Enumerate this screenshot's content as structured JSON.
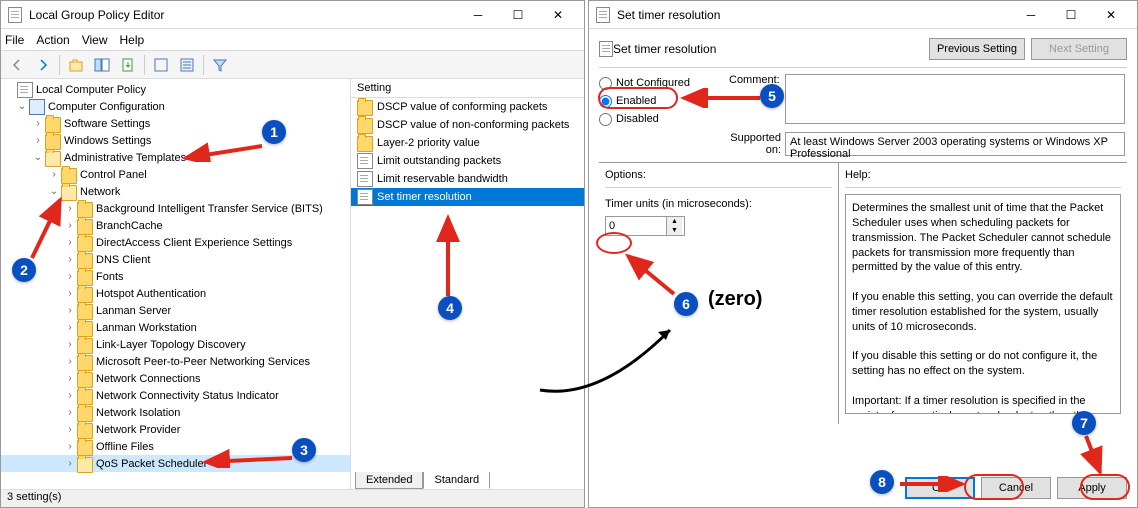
{
  "gpedit": {
    "title": "Local Group Policy Editor",
    "menus": [
      "File",
      "Action",
      "View",
      "Help"
    ],
    "status": "3 setting(s)",
    "root": "Local Computer Policy",
    "cc": "Computer Configuration",
    "tree_top": [
      "Software Settings",
      "Windows Settings",
      "Administrative Templates"
    ],
    "at_children": [
      "Control Panel",
      "Network"
    ],
    "network_children": [
      "Background Intelligent Transfer Service (BITS)",
      "BranchCache",
      "DirectAccess Client Experience Settings",
      "DNS Client",
      "Fonts",
      "Hotspot Authentication",
      "Lanman Server",
      "Lanman Workstation",
      "Link-Layer Topology Discovery",
      "Microsoft Peer-to-Peer Networking Services",
      "Network Connections",
      "Network Connectivity Status Indicator",
      "Network Isolation",
      "Network Provider",
      "Offline Files",
      "QoS Packet Scheduler"
    ],
    "list_header": "Setting",
    "list_items": [
      "DSCP value of conforming packets",
      "DSCP value of non-conforming packets",
      "Layer-2 priority value",
      "Limit outstanding packets",
      "Limit reservable bandwidth",
      "Set timer resolution"
    ],
    "selected_index": 5,
    "tabs": [
      "Extended",
      "Standard"
    ]
  },
  "dialog": {
    "title": "Set timer resolution",
    "header": "Set timer resolution",
    "prev_btn": "Previous Setting",
    "next_btn": "Next Setting",
    "radios": {
      "nc": "Not Configured",
      "en": "Enabled",
      "dis": "Disabled"
    },
    "selected_radio": "en",
    "comment_lbl": "Comment:",
    "supported_lbl": "Supported on:",
    "supported_txt": "At least Windows Server 2003 operating systems or Windows XP Professional",
    "options_lbl": "Options:",
    "help_lbl": "Help:",
    "timer_lbl": "Timer units (in microseconds):",
    "timer_value": "0",
    "help_text": "Determines the smallest unit of time that the Packet Scheduler uses when scheduling packets for transmission. The Packet Scheduler cannot schedule packets for transmission more frequently than permitted by the value of this entry.\n\nIf you enable this setting, you can override the default timer resolution established for the system, usually units of 10 microseconds.\n\nIf you disable this setting or do not configure it, the setting has no effect on the system.\n\nImportant: If a timer resolution is specified in the registry for a particular network adapter, then this setting is ignored when configuring that network adapter.",
    "ok": "OK",
    "cancel": "Cancel",
    "apply": "Apply"
  },
  "ann": {
    "zero": "(zero)"
  }
}
